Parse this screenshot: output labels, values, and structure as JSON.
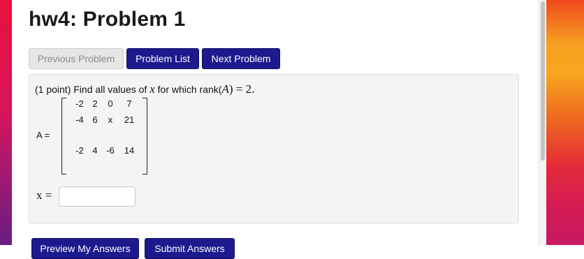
{
  "page_title": "hw4: Problem 1",
  "nav": {
    "previous": "Previous Problem",
    "list": "Problem List",
    "next": "Next Problem"
  },
  "problem": {
    "points": "(1 point) Find all values of",
    "var": "x",
    "middle": "for which rank(",
    "matrix_name": "A",
    "tail": ") = 2.",
    "matrix_label": "A =",
    "matrix": [
      [
        "-2",
        "2",
        "0",
        "7"
      ],
      [
        "-4",
        "6",
        "x",
        "21"
      ],
      [
        "-2",
        "4",
        "-6",
        "14"
      ]
    ],
    "answer_label": "x =",
    "answer_value": ""
  },
  "bottom_buttons": {
    "preview": "Preview My Answers",
    "submit": "Submit Answers"
  },
  "colors": {
    "primary_button": "#1d1a8e",
    "disabled_button": "#e6e6e6",
    "problem_background": "#f4f4f4"
  }
}
